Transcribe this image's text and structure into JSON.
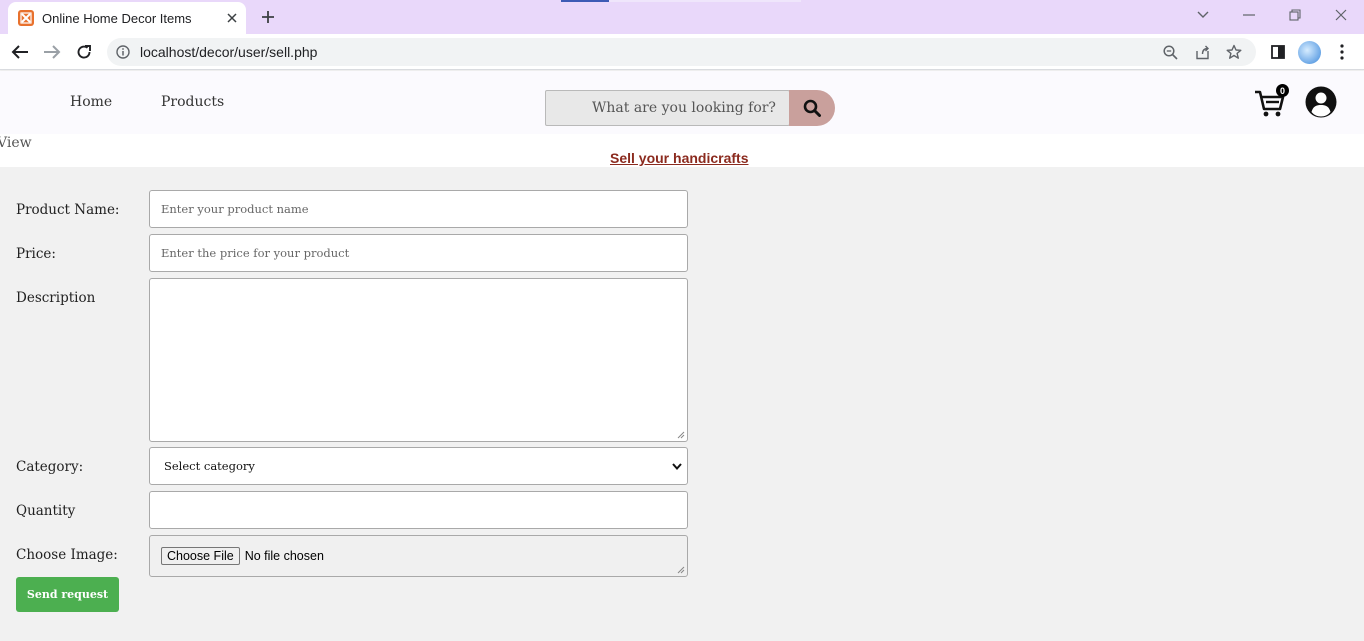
{
  "browser": {
    "tab_title": "Online Home Decor Items",
    "url": "localhost/decor/user/sell.php"
  },
  "navbar": {
    "links": [
      {
        "label": "Home"
      },
      {
        "label": "Products"
      }
    ],
    "search_placeholder": "What are you looking for?",
    "cart_count": "0"
  },
  "page": {
    "view_label": "View",
    "title": "Sell your handicrafts"
  },
  "form": {
    "product_name_label": "Product Name:",
    "product_name_placeholder": "Enter your product name",
    "price_label": "Price:",
    "price_placeholder": "Enter the price for your product",
    "description_label": "Description",
    "category_label": "Category:",
    "category_selected": "Select category",
    "quantity_label": "Quantity",
    "image_label": "Choose Image:",
    "choose_file_button": "Choose File",
    "file_status": "No file chosen",
    "submit_label": "Send request"
  },
  "colors": {
    "tab_strip": "#e9d8fa",
    "search_button": "#c9a09c",
    "title_link": "#8b2a1e",
    "submit_button": "#4caf50"
  }
}
